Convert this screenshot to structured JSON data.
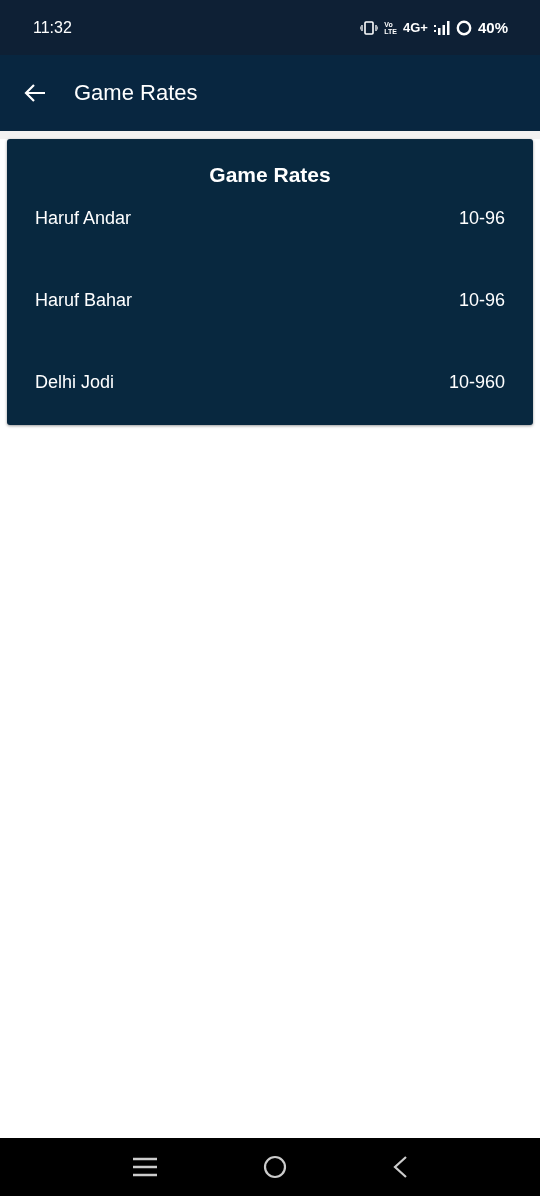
{
  "status_bar": {
    "time": "11:32",
    "volte": [
      "Vo",
      "LTE"
    ],
    "network": "4G+",
    "battery": "40%"
  },
  "app_bar": {
    "title": "Game Rates"
  },
  "card": {
    "title": "Game Rates",
    "rows": [
      {
        "name": "Haruf Andar",
        "rate": "10-96"
      },
      {
        "name": "Haruf Bahar",
        "rate": "10-96"
      },
      {
        "name": "Delhi Jodi",
        "rate": "10-960"
      }
    ]
  }
}
